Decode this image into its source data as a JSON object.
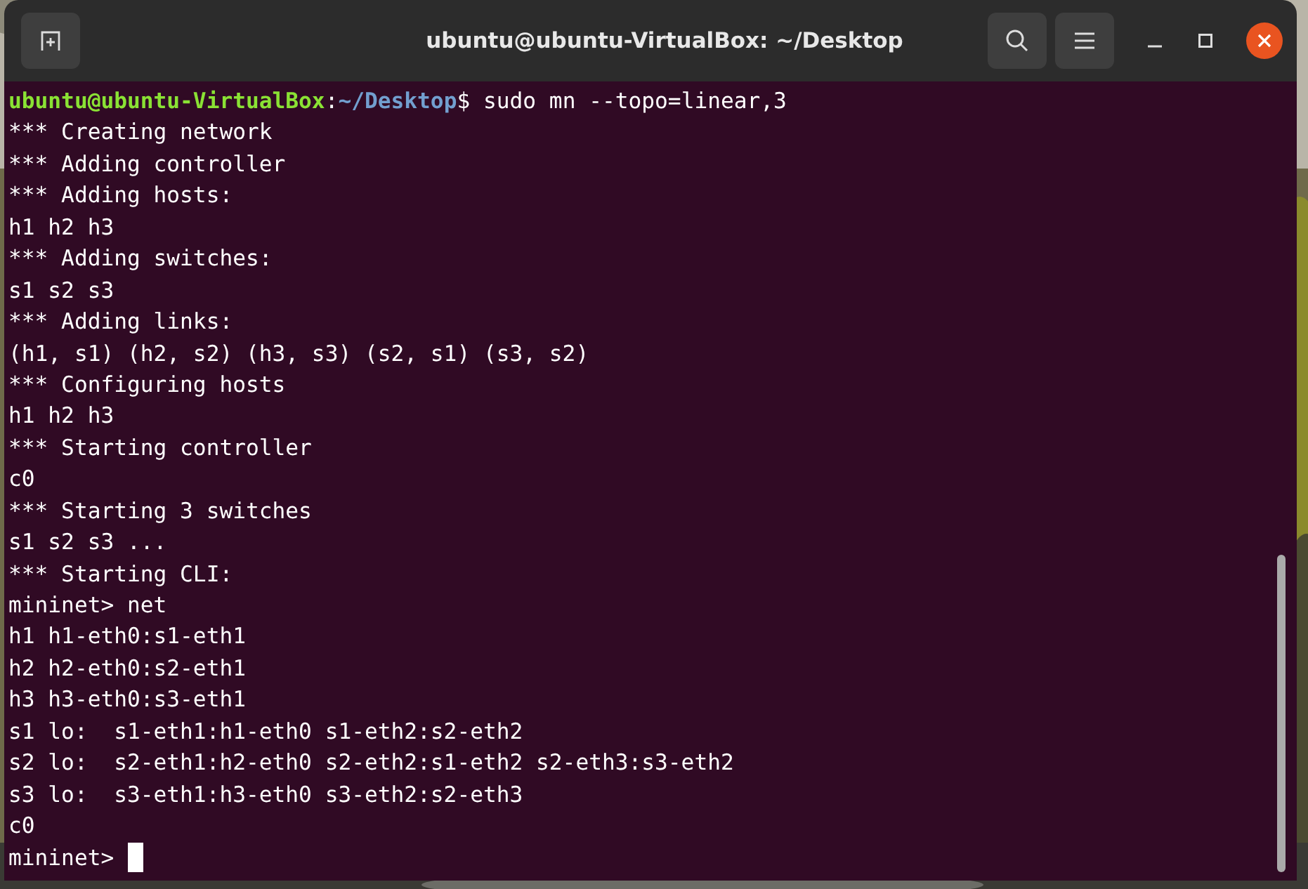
{
  "window": {
    "title": "ubuntu@ubuntu-VirtualBox: ~/Desktop"
  },
  "terminal": {
    "lines": [
      {
        "segments": [
          {
            "kind": "user",
            "text": "ubuntu@ubuntu-VirtualBox"
          },
          {
            "kind": "plain",
            "text": ":"
          },
          {
            "kind": "path",
            "text": "~/Desktop"
          },
          {
            "kind": "plain",
            "text": "$ sudo mn --topo=linear,3"
          }
        ]
      },
      {
        "segments": [
          {
            "kind": "plain",
            "text": "*** Creating network"
          }
        ]
      },
      {
        "segments": [
          {
            "kind": "plain",
            "text": "*** Adding controller"
          }
        ]
      },
      {
        "segments": [
          {
            "kind": "plain",
            "text": "*** Adding hosts:"
          }
        ]
      },
      {
        "segments": [
          {
            "kind": "plain",
            "text": "h1 h2 h3"
          }
        ]
      },
      {
        "segments": [
          {
            "kind": "plain",
            "text": "*** Adding switches:"
          }
        ]
      },
      {
        "segments": [
          {
            "kind": "plain",
            "text": "s1 s2 s3"
          }
        ]
      },
      {
        "segments": [
          {
            "kind": "plain",
            "text": "*** Adding links:"
          }
        ]
      },
      {
        "segments": [
          {
            "kind": "plain",
            "text": "(h1, s1) (h2, s2) (h3, s3) (s2, s1) (s3, s2)"
          }
        ]
      },
      {
        "segments": [
          {
            "kind": "plain",
            "text": "*** Configuring hosts"
          }
        ]
      },
      {
        "segments": [
          {
            "kind": "plain",
            "text": "h1 h2 h3"
          }
        ]
      },
      {
        "segments": [
          {
            "kind": "plain",
            "text": "*** Starting controller"
          }
        ]
      },
      {
        "segments": [
          {
            "kind": "plain",
            "text": "c0"
          }
        ]
      },
      {
        "segments": [
          {
            "kind": "plain",
            "text": "*** Starting 3 switches"
          }
        ]
      },
      {
        "segments": [
          {
            "kind": "plain",
            "text": "s1 s2 s3 ..."
          }
        ]
      },
      {
        "segments": [
          {
            "kind": "plain",
            "text": "*** Starting CLI:"
          }
        ]
      },
      {
        "segments": [
          {
            "kind": "plain",
            "text": "mininet> net"
          }
        ]
      },
      {
        "segments": [
          {
            "kind": "plain",
            "text": "h1 h1-eth0:s1-eth1"
          }
        ]
      },
      {
        "segments": [
          {
            "kind": "plain",
            "text": "h2 h2-eth0:s2-eth1"
          }
        ]
      },
      {
        "segments": [
          {
            "kind": "plain",
            "text": "h3 h3-eth0:s3-eth1"
          }
        ]
      },
      {
        "segments": [
          {
            "kind": "plain",
            "text": "s1 lo:  s1-eth1:h1-eth0 s1-eth2:s2-eth2"
          }
        ]
      },
      {
        "segments": [
          {
            "kind": "plain",
            "text": "s2 lo:  s2-eth1:h2-eth0 s2-eth2:s1-eth2 s2-eth3:s3-eth2"
          }
        ]
      },
      {
        "segments": [
          {
            "kind": "plain",
            "text": "s3 lo:  s3-eth1:h3-eth0 s3-eth2:s2-eth3"
          }
        ]
      },
      {
        "segments": [
          {
            "kind": "plain",
            "text": "c0"
          }
        ]
      },
      {
        "segments": [
          {
            "kind": "plain",
            "text": "mininet> "
          }
        ],
        "cursor": true
      }
    ]
  }
}
